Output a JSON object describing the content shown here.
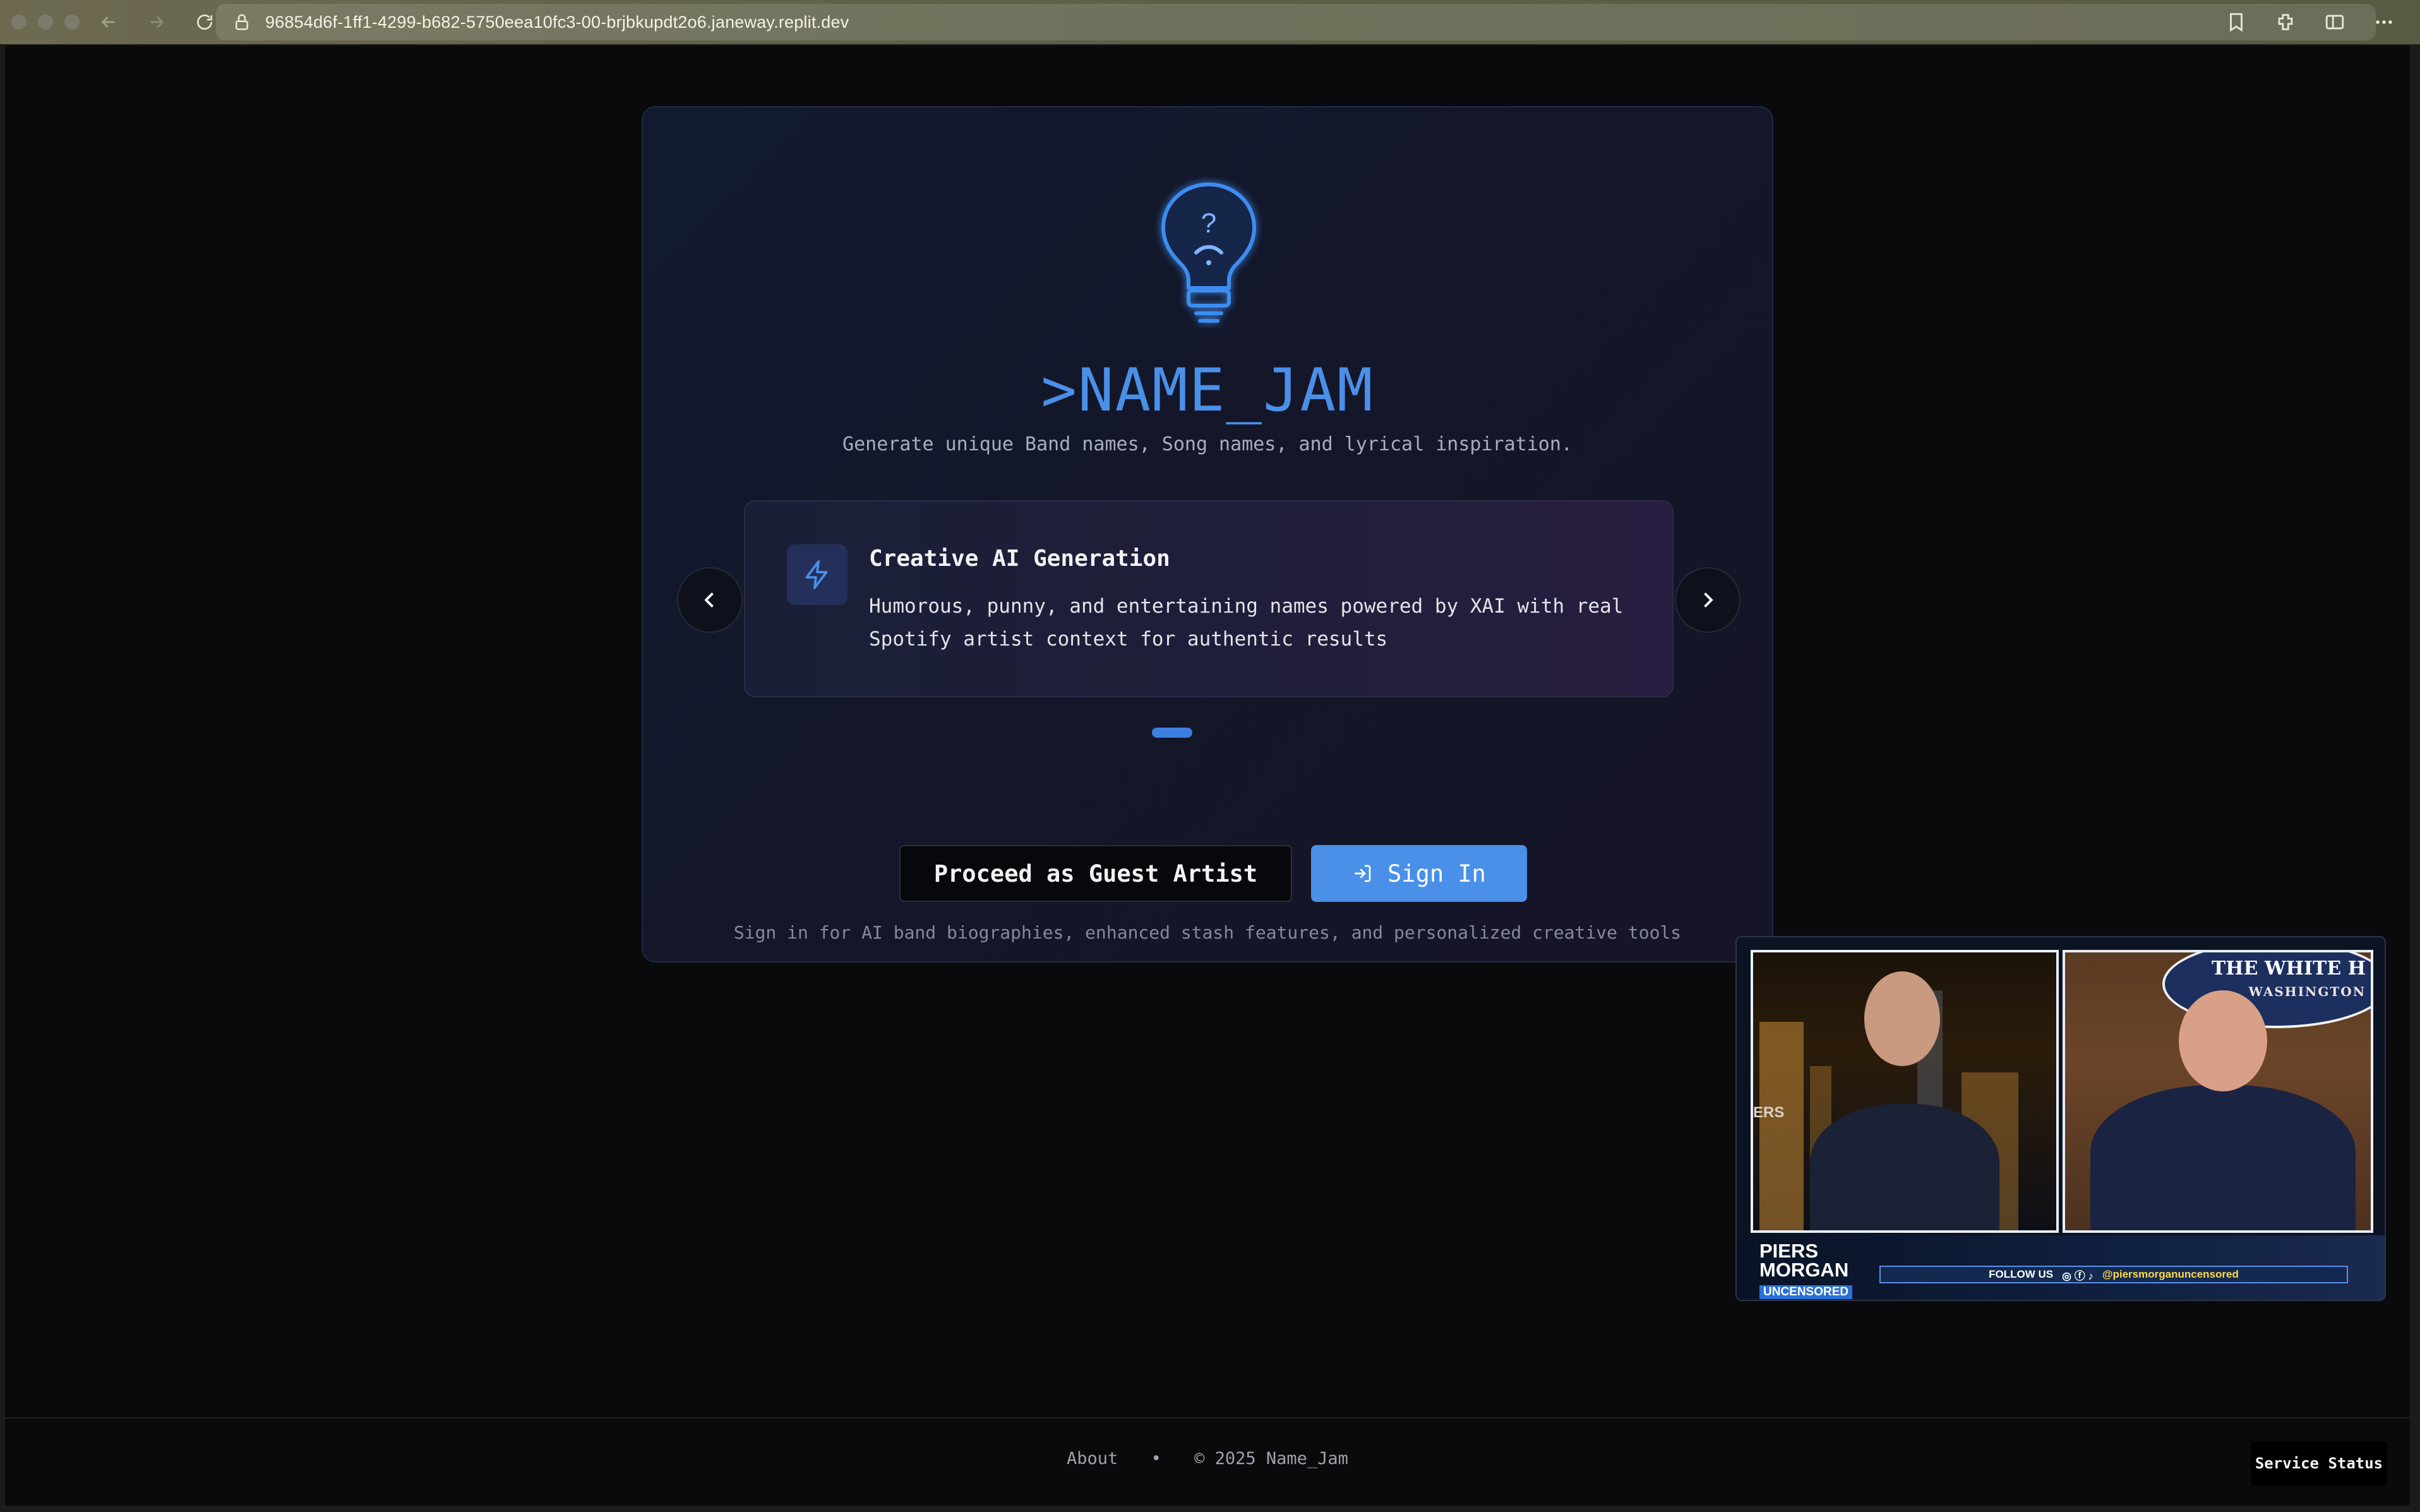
{
  "browser": {
    "url": "96854d6f-1ff1-4299-b682-5750eea10fc3-00-brjbkupdt2o6.janeway.replit.dev"
  },
  "app": {
    "title": ">NAME_JAM",
    "subtitle": "Generate unique Band names, Song names, and lyrical inspiration.",
    "accent_color": "#4a90e8"
  },
  "carousel": {
    "feature_title": "Creative AI Generation",
    "feature_description": "Humorous, punny, and entertaining names powered by XAI with real Spotify artist context for authentic results",
    "feature_icon": "lightning-icon",
    "active_index": 0,
    "total_slides": 1
  },
  "actions": {
    "guest_label": "Proceed as Guest Artist",
    "signin_label": "Sign In",
    "hint": "Sign in for AI band biographies, enhanced stash features, and personalized creative tools"
  },
  "pip": {
    "overlay_title": "THE WHITE H",
    "overlay_subtitle": "WASHINGTON",
    "logo_line1": "PIERS",
    "logo_line2": "MORGAN",
    "logo_tag": "UNCENSORED",
    "follow_label": "FOLLOW US",
    "handle": "@piersmorganuncensored",
    "partial_text": "ERS"
  },
  "footer": {
    "about": "About",
    "separator": "•",
    "copyright": "© 2025 Name_Jam",
    "status_button": "Service Status"
  }
}
